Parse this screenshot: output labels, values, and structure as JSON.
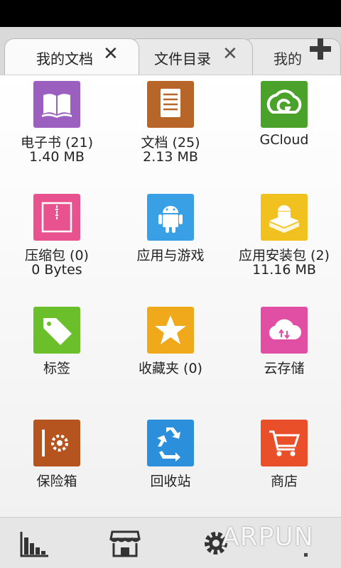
{
  "tabs": [
    {
      "label": "我的文档",
      "active": true,
      "close": "✕"
    },
    {
      "label": "文件目录",
      "active": false,
      "close": "✕"
    },
    {
      "label": "我的",
      "active": false
    }
  ],
  "add_tab_icon": "plus-icon",
  "grid": [
    {
      "label": "电子书 (21)",
      "sub": "1.40 MB",
      "icon": "book-icon",
      "color": "#9b5fc0"
    },
    {
      "label": "文档 (25)",
      "sub": "2.13 MB",
      "icon": "document-icon",
      "color": "#b8652a"
    },
    {
      "label": "GCloud",
      "sub": "",
      "icon": "gcloud-icon",
      "color": "#4aa22a"
    },
    {
      "label": "压缩包 (0)",
      "sub": "0 Bytes",
      "icon": "zip-icon",
      "color": "#e8528f"
    },
    {
      "label": "应用与游戏",
      "sub": "",
      "icon": "android-icon",
      "color": "#3aa0e6"
    },
    {
      "label": "应用安装包 (2)",
      "sub": "11.16 MB",
      "icon": "apk-icon",
      "color": "#f1c21f"
    },
    {
      "label": "标签",
      "sub": "",
      "icon": "tag-icon",
      "color": "#6bbf2a"
    },
    {
      "label": "收藏夹 (0)",
      "sub": "",
      "icon": "star-icon",
      "color": "#f0a91a"
    },
    {
      "label": "云存储",
      "sub": "",
      "icon": "cloud-icon",
      "color": "#e04fa3"
    },
    {
      "label": "保险箱",
      "sub": "",
      "icon": "safe-icon",
      "color": "#b5541f"
    },
    {
      "label": "回收站",
      "sub": "",
      "icon": "recycle-icon",
      "color": "#2b8fdb"
    },
    {
      "label": "商店",
      "sub": "",
      "icon": "cart-icon",
      "color": "#e9502a"
    }
  ],
  "bottom_bar": [
    "stats-icon",
    "store-icon",
    "settings-icon",
    "more-icon"
  ],
  "watermark": "ARPUN"
}
